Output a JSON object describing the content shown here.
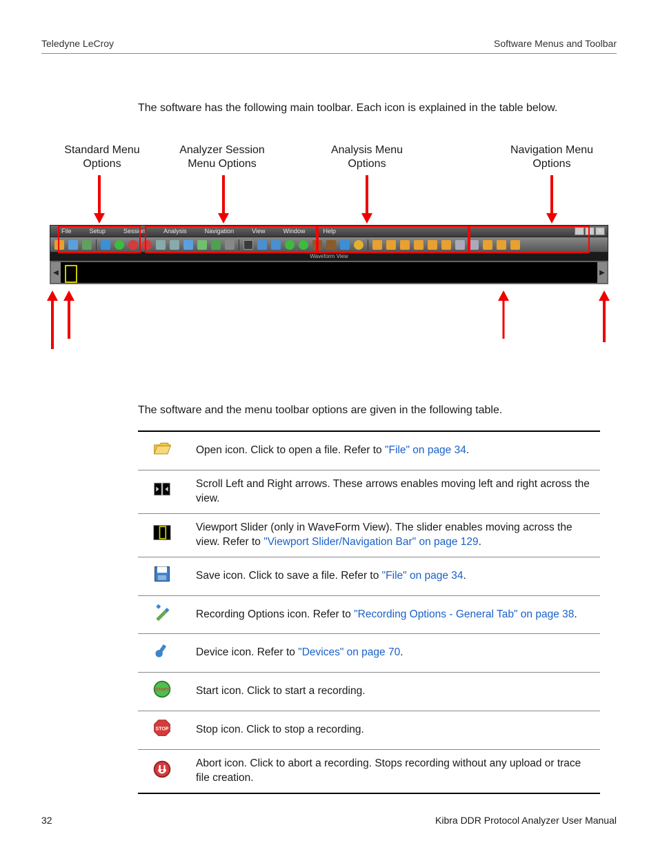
{
  "header": {
    "left": "Teledyne LeCroy",
    "right": "Software Menus and Toolbar"
  },
  "intro": "The software has the following main toolbar. Each icon is explained in the table below.",
  "callouts": {
    "standard": "Standard Menu Options",
    "session": "Analyzer Session Menu Options",
    "analysis": "Analysis Menu Options",
    "navigation": "Navigation Menu Options"
  },
  "menubar": [
    "File",
    "Setup",
    "Session",
    "Analysis",
    "Navigation",
    "View",
    "Window",
    "Help"
  ],
  "waveform_label": "Waveform View",
  "intro2": "The software and the menu toolbar options are given in the following table.",
  "table": [
    {
      "icon": "open-icon",
      "parts": [
        {
          "t": "Open icon. Click to open a file. Refer to "
        },
        {
          "t": "\"File\" on page 34",
          "link": true
        },
        {
          "t": "."
        }
      ]
    },
    {
      "icon": "scroll-icon",
      "parts": [
        {
          "t": "Scroll Left and Right arrows. These arrows enables moving left and right across the view."
        }
      ]
    },
    {
      "icon": "viewport-slider-icon",
      "parts": [
        {
          "t": "Viewport Slider (only in WaveForm View). The slider enables moving across the view. Refer to "
        },
        {
          "t": "\"Viewport Slider/Navigation Bar\" on page 129",
          "link": true
        },
        {
          "t": "."
        }
      ]
    },
    {
      "icon": "save-icon",
      "parts": [
        {
          "t": "Save icon. Click to save a file. Refer to "
        },
        {
          "t": "\"File\" on page 34",
          "link": true
        },
        {
          "t": "."
        }
      ]
    },
    {
      "icon": "recording-options-icon",
      "parts": [
        {
          "t": "Recording Options icon. Refer to "
        },
        {
          "t": "\"Recording Options - General Tab\" on page 38",
          "link": true
        },
        {
          "t": "."
        }
      ]
    },
    {
      "icon": "device-icon",
      "parts": [
        {
          "t": "Device icon. Refer to "
        },
        {
          "t": "\"Devices\" on page 70",
          "link": true
        },
        {
          "t": "."
        }
      ]
    },
    {
      "icon": "start-icon",
      "parts": [
        {
          "t": "Start icon. Click to start a recording."
        }
      ]
    },
    {
      "icon": "stop-icon",
      "parts": [
        {
          "t": "Stop icon. Click to stop a recording."
        }
      ]
    },
    {
      "icon": "abort-icon",
      "parts": [
        {
          "t": "Abort icon. Click to abort a recording. Stops recording without any upload or trace file creation."
        }
      ]
    }
  ],
  "footer": {
    "page": "32",
    "title": "Kibra DDR Protocol Analyzer User Manual"
  }
}
